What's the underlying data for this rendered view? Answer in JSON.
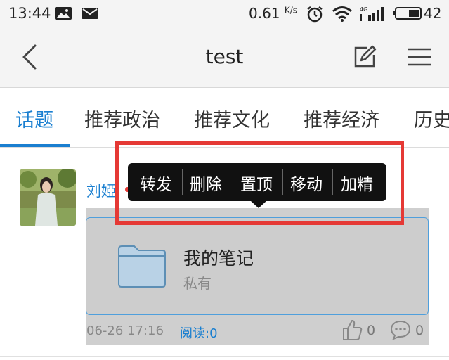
{
  "status_bar": {
    "time": "13:44",
    "net_speed": "0.61",
    "net_unit": "K/s",
    "battery": "42"
  },
  "nav": {
    "title": "test"
  },
  "tabs": [
    {
      "label": "话题",
      "active": true
    },
    {
      "label": "推荐政治"
    },
    {
      "label": "推荐文化"
    },
    {
      "label": "推荐经济"
    },
    {
      "label": "历史"
    }
  ],
  "post": {
    "author": "刘婭",
    "note_title": "我的笔记",
    "note_subtitle": "私有",
    "date": "06-26 17:16",
    "read": "阅读:0",
    "likes": "0",
    "comments": "0"
  },
  "context_menu": {
    "items": [
      "转发",
      "删除",
      "置顶",
      "移动",
      "加精"
    ]
  },
  "colors": {
    "accent": "#1a7fd0",
    "highlight": "#e53935",
    "popup_bg": "#111111"
  }
}
